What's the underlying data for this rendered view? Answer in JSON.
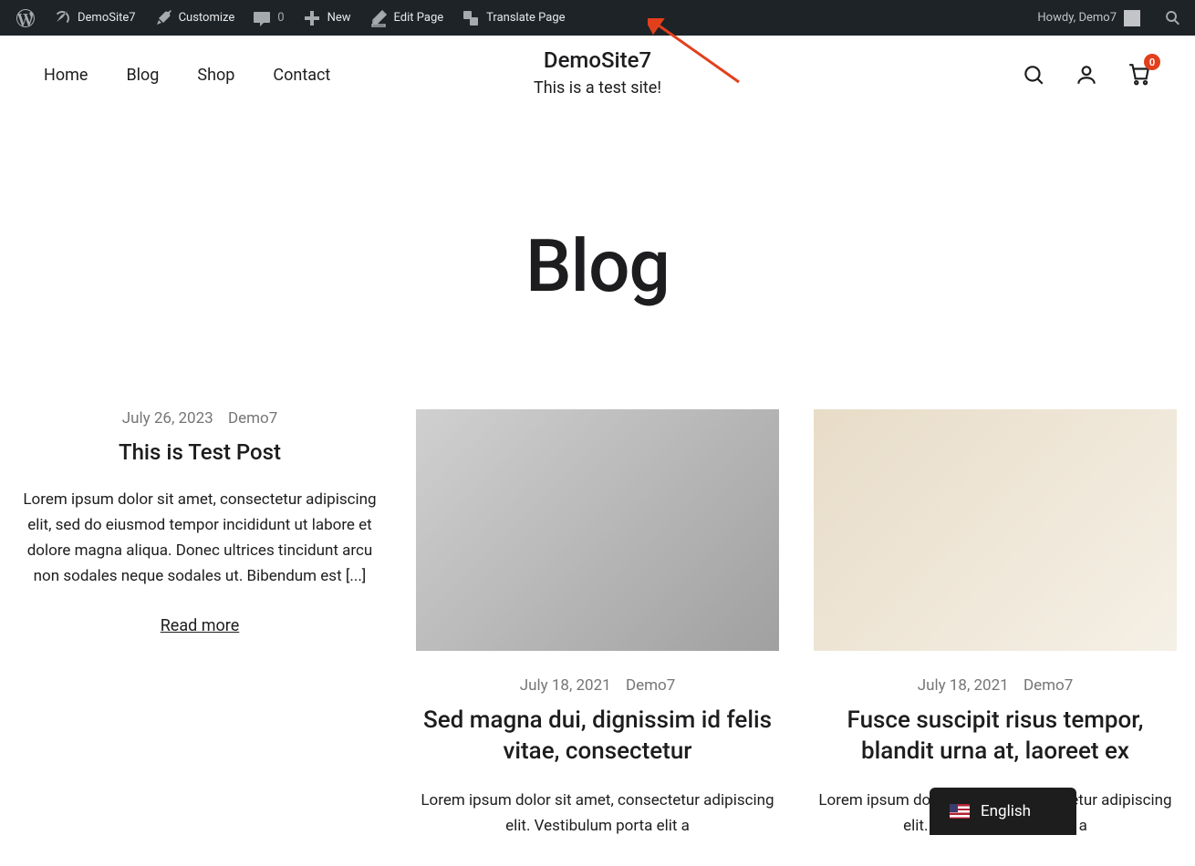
{
  "adminBar": {
    "siteName": "DemoSite7",
    "customize": "Customize",
    "commentCount": "0",
    "new": "New",
    "editPage": "Edit Page",
    "translatePage": "Translate Page",
    "howdy": "Howdy, Demo7"
  },
  "header": {
    "nav": [
      "Home",
      "Blog",
      "Shop",
      "Contact"
    ],
    "siteTitle": "DemoSite7",
    "tagline": "This is a test site!",
    "cartCount": "0"
  },
  "pageTitle": "Blog",
  "posts": [
    {
      "date": "July 26, 2023",
      "author": "Demo7",
      "title": "This is Test Post",
      "excerpt": "Lorem ipsum dolor sit amet, consectetur adipiscing elit, sed do eiusmod tempor incididunt ut labore et dolore magna aliqua. Donec ultrices tincidunt arcu non sodales neque sodales ut. Bibendum est [...]",
      "readMore": "Read more"
    },
    {
      "date": "July 18, 2021",
      "author": "Demo7",
      "title": "Sed magna dui, dignissim id felis vitae, consectetur",
      "excerpt": "Lorem ipsum dolor sit amet, consectetur adipiscing elit. Vestibulum porta elit a"
    },
    {
      "date": "July 18, 2021",
      "author": "Demo7",
      "title": "Fusce suscipit risus tempor, blandit urna at, laoreet ex",
      "excerpt": "Lorem ipsum dolor sit amet, consectetur adipiscing elit. Vestibulum porta elit a"
    }
  ],
  "langSwitcher": {
    "current": "English"
  }
}
